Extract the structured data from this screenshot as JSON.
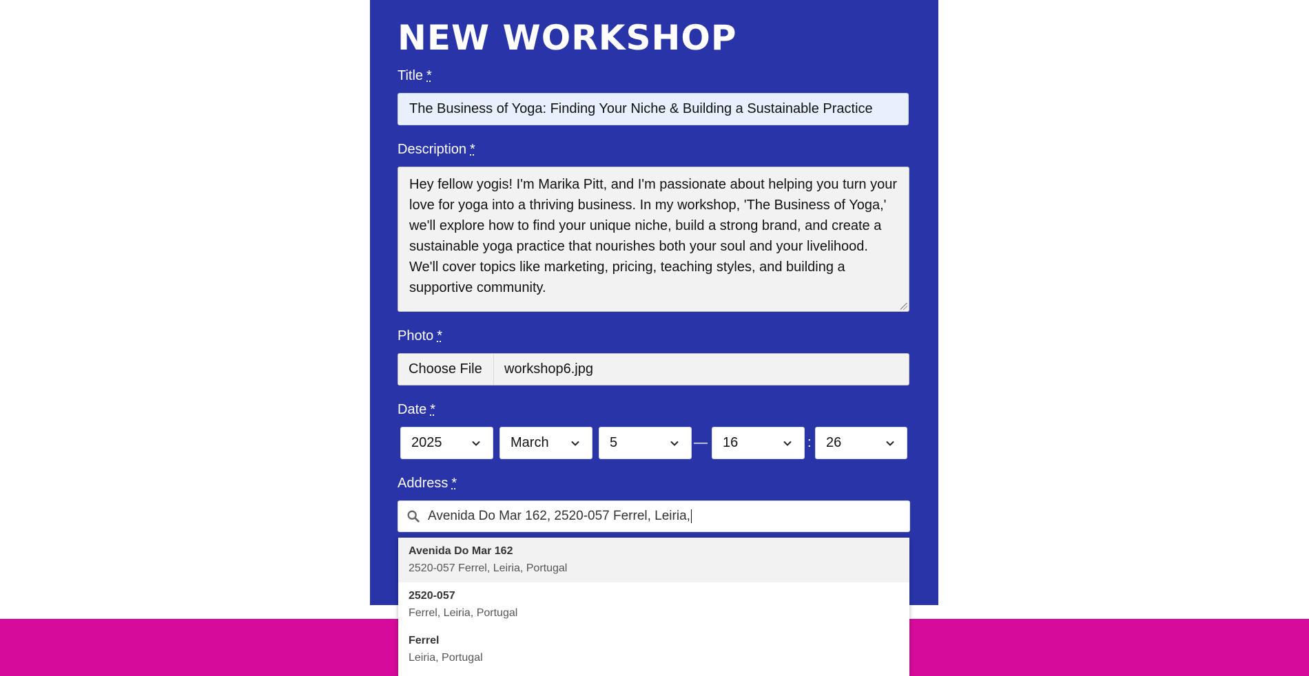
{
  "form": {
    "title": "NEW WORKSHOP",
    "required_marker": "*",
    "fields": {
      "title": {
        "label": "Title",
        "value": "The Business of Yoga: Finding Your Niche & Building a Sustainable Practice"
      },
      "description": {
        "label": "Description",
        "value": "Hey fellow yogis! I'm Marika Pitt, and I'm passionate about helping you turn your love for yoga into a thriving business. In my workshop, 'The Business of Yoga,' we'll explore how to find your unique niche, build a strong brand, and create a sustainable yoga practice that nourishes both your soul and your livelihood. We'll cover topics like marketing, pricing, teaching styles, and building a supportive community."
      },
      "photo": {
        "label": "Photo",
        "button_label": "Choose File",
        "file_name": "workshop6.jpg"
      },
      "date": {
        "label": "Date",
        "year": "2025",
        "month": "March",
        "day": "5",
        "dash": "—",
        "hour": "16",
        "colon": ":",
        "minute": "26"
      },
      "address": {
        "label": "Address",
        "value": "Avenida Do Mar 162, 2520-057 Ferrel, Leiria,",
        "suggestions": [
          {
            "main": "Avenida Do Mar 162",
            "sub": "2520-057 Ferrel, Leiria, Portugal"
          },
          {
            "main": "2520-057",
            "sub": "Ferrel, Leiria, Portugal"
          },
          {
            "main": "Ferrel",
            "sub": "Leiria, Portugal"
          }
        ]
      }
    }
  },
  "colors": {
    "panel": "#2834a7",
    "footer": "#d60b9b",
    "autofill_bg": "#e8f0fe",
    "field_bg": "#f2f2f2"
  },
  "icons": [
    "search-icon",
    "chevron-down-icon",
    "resize-grip-icon"
  ]
}
